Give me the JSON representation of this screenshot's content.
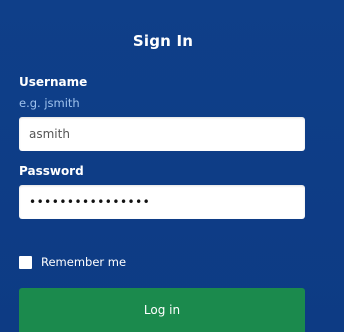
{
  "form": {
    "title": "Sign In",
    "username": {
      "label": "Username",
      "hint": "e.g. jsmith",
      "value": "asmith"
    },
    "password": {
      "label": "Password",
      "value": "••••••••••••••••"
    },
    "remember_me": {
      "label": "Remember me",
      "checked": false
    },
    "submit_label": "Log in"
  },
  "colors": {
    "background": "#0e3d86",
    "hint": "#9fc3ee",
    "button": "#1b8a4d",
    "text": "#ffffff"
  }
}
